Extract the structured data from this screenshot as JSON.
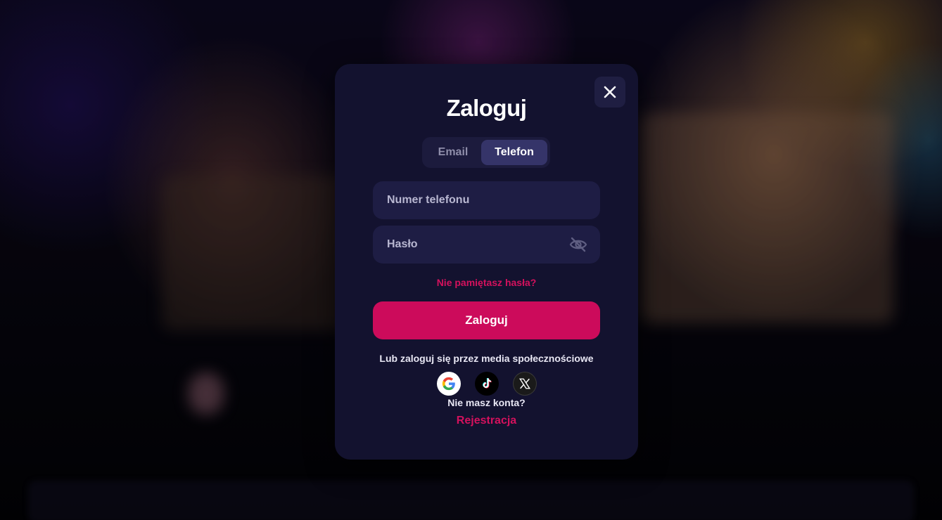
{
  "modal": {
    "title": "Zaloguj",
    "tabs": [
      {
        "label": "Email",
        "active": false
      },
      {
        "label": "Telefon",
        "active": true
      }
    ],
    "phone_field": {
      "placeholder": "Numer telefonu",
      "value": ""
    },
    "password_field": {
      "placeholder": "Hasło",
      "value": "",
      "icon": "eye-off-icon"
    },
    "forgot_password": "Nie pamiętasz hasła?",
    "submit_label": "Zaloguj",
    "social_label": "Lub zaloguj się przez media społecznościowe",
    "socials": [
      {
        "icon": "google-icon"
      },
      {
        "icon": "tiktok-icon"
      },
      {
        "icon": "x-icon"
      }
    ],
    "no_account": "Nie masz konta?",
    "register_label": "Rejestracja",
    "close_icon": "close-icon"
  },
  "colors": {
    "modal_bg": "#13122f",
    "accent": "#cc0b5b",
    "link": "#d4115d",
    "field_bg": "#1e1d44",
    "tab_active_bg": "#353469"
  }
}
